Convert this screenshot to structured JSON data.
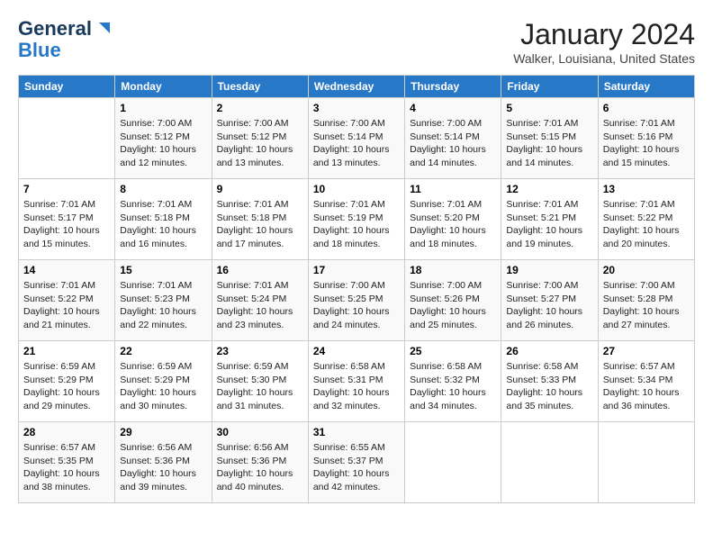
{
  "logo": {
    "line1": "General",
    "line2": "Blue"
  },
  "title": "January 2024",
  "location": "Walker, Louisiana, United States",
  "days_of_week": [
    "Sunday",
    "Monday",
    "Tuesday",
    "Wednesday",
    "Thursday",
    "Friday",
    "Saturday"
  ],
  "weeks": [
    [
      {
        "day": "",
        "content": ""
      },
      {
        "day": "1",
        "content": "Sunrise: 7:00 AM\nSunset: 5:12 PM\nDaylight: 10 hours\nand 12 minutes."
      },
      {
        "day": "2",
        "content": "Sunrise: 7:00 AM\nSunset: 5:12 PM\nDaylight: 10 hours\nand 13 minutes."
      },
      {
        "day": "3",
        "content": "Sunrise: 7:00 AM\nSunset: 5:14 PM\nDaylight: 10 hours\nand 13 minutes."
      },
      {
        "day": "4",
        "content": "Sunrise: 7:00 AM\nSunset: 5:14 PM\nDaylight: 10 hours\nand 14 minutes."
      },
      {
        "day": "5",
        "content": "Sunrise: 7:01 AM\nSunset: 5:15 PM\nDaylight: 10 hours\nand 14 minutes."
      },
      {
        "day": "6",
        "content": "Sunrise: 7:01 AM\nSunset: 5:16 PM\nDaylight: 10 hours\nand 15 minutes."
      }
    ],
    [
      {
        "day": "7",
        "content": "Sunrise: 7:01 AM\nSunset: 5:17 PM\nDaylight: 10 hours\nand 15 minutes."
      },
      {
        "day": "8",
        "content": "Sunrise: 7:01 AM\nSunset: 5:18 PM\nDaylight: 10 hours\nand 16 minutes."
      },
      {
        "day": "9",
        "content": "Sunrise: 7:01 AM\nSunset: 5:18 PM\nDaylight: 10 hours\nand 17 minutes."
      },
      {
        "day": "10",
        "content": "Sunrise: 7:01 AM\nSunset: 5:19 PM\nDaylight: 10 hours\nand 18 minutes."
      },
      {
        "day": "11",
        "content": "Sunrise: 7:01 AM\nSunset: 5:20 PM\nDaylight: 10 hours\nand 18 minutes."
      },
      {
        "day": "12",
        "content": "Sunrise: 7:01 AM\nSunset: 5:21 PM\nDaylight: 10 hours\nand 19 minutes."
      },
      {
        "day": "13",
        "content": "Sunrise: 7:01 AM\nSunset: 5:22 PM\nDaylight: 10 hours\nand 20 minutes."
      }
    ],
    [
      {
        "day": "14",
        "content": "Sunrise: 7:01 AM\nSunset: 5:22 PM\nDaylight: 10 hours\nand 21 minutes."
      },
      {
        "day": "15",
        "content": "Sunrise: 7:01 AM\nSunset: 5:23 PM\nDaylight: 10 hours\nand 22 minutes."
      },
      {
        "day": "16",
        "content": "Sunrise: 7:01 AM\nSunset: 5:24 PM\nDaylight: 10 hours\nand 23 minutes."
      },
      {
        "day": "17",
        "content": "Sunrise: 7:00 AM\nSunset: 5:25 PM\nDaylight: 10 hours\nand 24 minutes."
      },
      {
        "day": "18",
        "content": "Sunrise: 7:00 AM\nSunset: 5:26 PM\nDaylight: 10 hours\nand 25 minutes."
      },
      {
        "day": "19",
        "content": "Sunrise: 7:00 AM\nSunset: 5:27 PM\nDaylight: 10 hours\nand 26 minutes."
      },
      {
        "day": "20",
        "content": "Sunrise: 7:00 AM\nSunset: 5:28 PM\nDaylight: 10 hours\nand 27 minutes."
      }
    ],
    [
      {
        "day": "21",
        "content": "Sunrise: 6:59 AM\nSunset: 5:29 PM\nDaylight: 10 hours\nand 29 minutes."
      },
      {
        "day": "22",
        "content": "Sunrise: 6:59 AM\nSunset: 5:29 PM\nDaylight: 10 hours\nand 30 minutes."
      },
      {
        "day": "23",
        "content": "Sunrise: 6:59 AM\nSunset: 5:30 PM\nDaylight: 10 hours\nand 31 minutes."
      },
      {
        "day": "24",
        "content": "Sunrise: 6:58 AM\nSunset: 5:31 PM\nDaylight: 10 hours\nand 32 minutes."
      },
      {
        "day": "25",
        "content": "Sunrise: 6:58 AM\nSunset: 5:32 PM\nDaylight: 10 hours\nand 34 minutes."
      },
      {
        "day": "26",
        "content": "Sunrise: 6:58 AM\nSunset: 5:33 PM\nDaylight: 10 hours\nand 35 minutes."
      },
      {
        "day": "27",
        "content": "Sunrise: 6:57 AM\nSunset: 5:34 PM\nDaylight: 10 hours\nand 36 minutes."
      }
    ],
    [
      {
        "day": "28",
        "content": "Sunrise: 6:57 AM\nSunset: 5:35 PM\nDaylight: 10 hours\nand 38 minutes."
      },
      {
        "day": "29",
        "content": "Sunrise: 6:56 AM\nSunset: 5:36 PM\nDaylight: 10 hours\nand 39 minutes."
      },
      {
        "day": "30",
        "content": "Sunrise: 6:56 AM\nSunset: 5:36 PM\nDaylight: 10 hours\nand 40 minutes."
      },
      {
        "day": "31",
        "content": "Sunrise: 6:55 AM\nSunset: 5:37 PM\nDaylight: 10 hours\nand 42 minutes."
      },
      {
        "day": "",
        "content": ""
      },
      {
        "day": "",
        "content": ""
      },
      {
        "day": "",
        "content": ""
      }
    ]
  ]
}
